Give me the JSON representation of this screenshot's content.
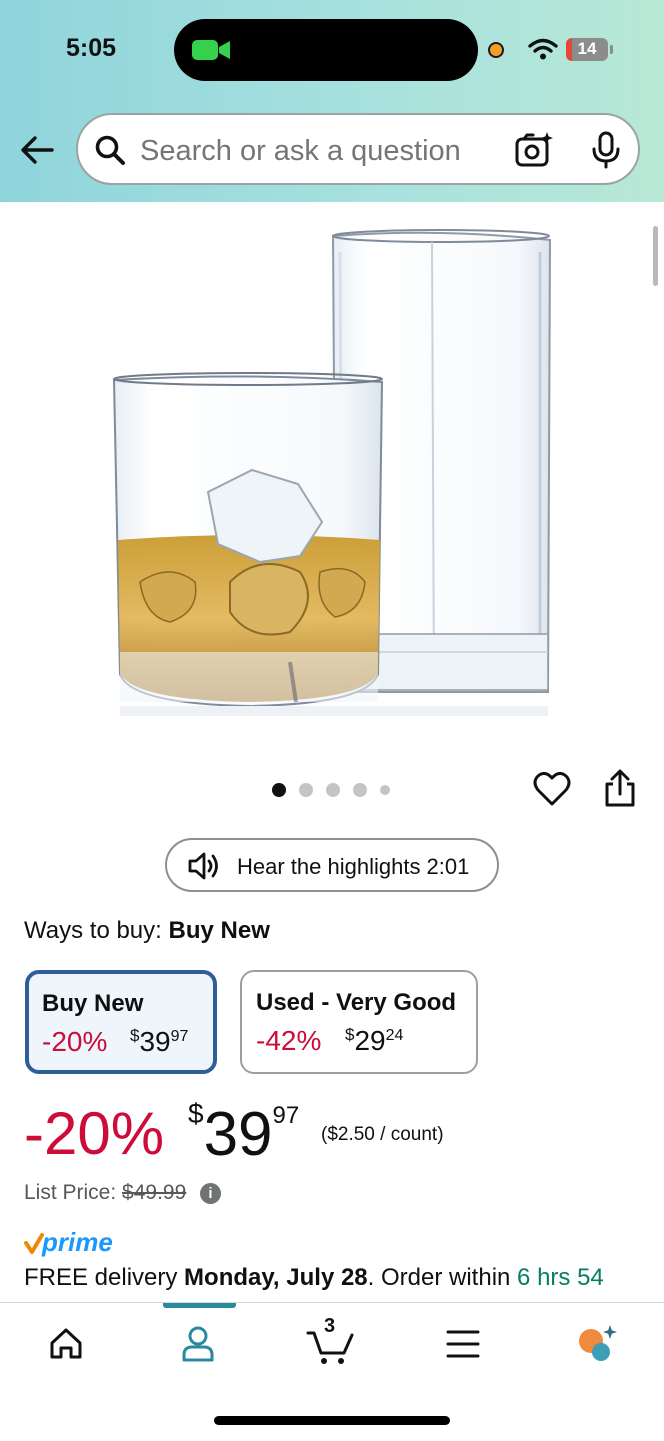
{
  "status_bar": {
    "time": "5:05",
    "battery_level": "14",
    "battery_fraction": 0.14,
    "icons": [
      "facetime-camera-icon",
      "mic-in-use-dot",
      "wifi-icon",
      "battery-icon"
    ]
  },
  "search": {
    "placeholder": "Search or ask a question",
    "icons": [
      "back-arrow-icon",
      "search-icon",
      "camera-lens-icon",
      "microphone-icon"
    ]
  },
  "gallery": {
    "image": "glassware set: rocks glass with whiskey and ice beside a tall highball glass",
    "dot_count": 5,
    "active_dot": 0
  },
  "actions": {
    "icons": [
      "heart-icon",
      "share-icon"
    ]
  },
  "audio": {
    "label": "Hear the highlights 2:01"
  },
  "ways_to_buy": {
    "label": "Ways to buy:",
    "selected": "Buy New"
  },
  "options": [
    {
      "title": "Buy New",
      "discount": "-20%",
      "symbol": "$",
      "whole": "39",
      "fraction": "97",
      "selected": true
    },
    {
      "title": "Used - Very Good",
      "discount": "-42%",
      "symbol": "$",
      "whole": "29",
      "fraction": "24",
      "selected": false
    }
  ],
  "price": {
    "discount": "-20%",
    "symbol": "$",
    "whole": "39",
    "fraction": "97",
    "per_count": "($2.50 / count)",
    "list_label": "List Price:",
    "list_value": "$49.99"
  },
  "prime": {
    "logo_text": "prime"
  },
  "delivery": {
    "prefix": "FREE delivery ",
    "date": "Monday, July 28",
    "middle": ". Order within ",
    "countdown": "6 hrs 54"
  },
  "bottom_nav": {
    "items": [
      "home-icon",
      "account-icon",
      "cart-icon",
      "menu-icon",
      "rufus-ai-icon"
    ],
    "active": "account-icon",
    "cart_count": "3"
  },
  "colors": {
    "deal_red": "#cc0c39",
    "prime_blue": "#1a98ff",
    "selected_border": "#2f5d98",
    "countdown_green": "#067d62",
    "header_gradient_start": "#8fd4dc",
    "header_gradient_end": "#b8e8d6"
  }
}
